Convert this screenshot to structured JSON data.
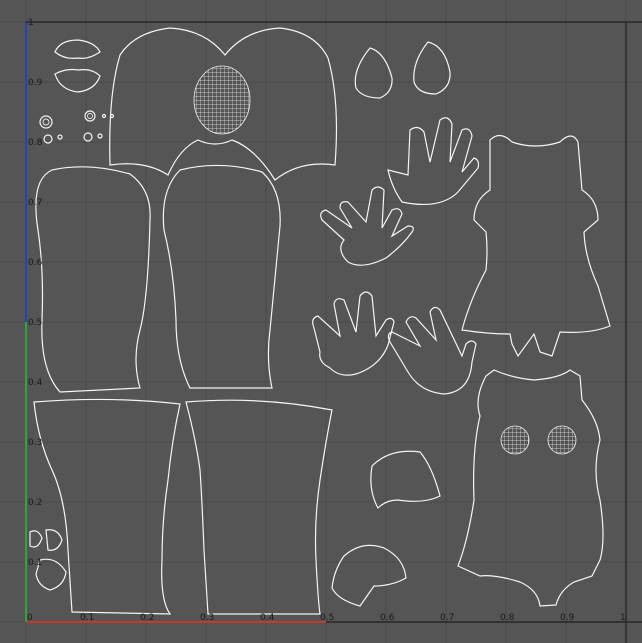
{
  "axis": {
    "u_labels": [
      "0",
      "0.1",
      "0.2",
      "0.3",
      "0.4",
      "0.5",
      "0.6",
      "0.7",
      "0.8",
      "0.9",
      "1"
    ],
    "v_labels": [
      "0.1",
      "0.2",
      "0.3",
      "0.4",
      "0.5",
      "0.6",
      "0.7",
      "0.8",
      "0.9",
      "1"
    ]
  },
  "colors": {
    "background": "#555555",
    "grid_line": "#4a4a4a",
    "wireframe": "#ececec",
    "u_axis": "#c23a2f",
    "v_axis_lower": "#2fa53a",
    "v_axis_upper": "#2b3fc0",
    "uv_border": "#1e1e1e"
  },
  "uv_shells": [
    {
      "name": "lip-upper"
    },
    {
      "name": "lip-lower"
    },
    {
      "name": "eye-rings"
    },
    {
      "name": "head"
    },
    {
      "name": "ear-left"
    },
    {
      "name": "ear-right"
    },
    {
      "name": "hand-upper-right"
    },
    {
      "name": "hand-mid-left"
    },
    {
      "name": "hand-lower-left"
    },
    {
      "name": "hand-lower-right"
    },
    {
      "name": "torso-back"
    },
    {
      "name": "torso-front"
    },
    {
      "name": "arm-left"
    },
    {
      "name": "arm-right"
    },
    {
      "name": "leg-left"
    },
    {
      "name": "leg-right"
    },
    {
      "name": "foot-upper"
    },
    {
      "name": "foot-lower"
    },
    {
      "name": "toes"
    }
  ]
}
